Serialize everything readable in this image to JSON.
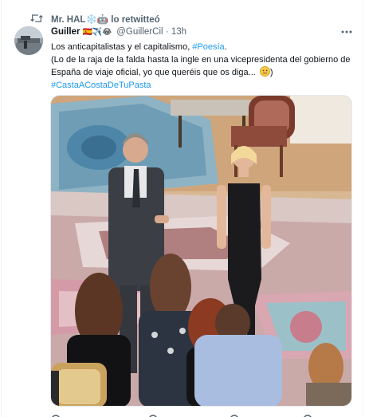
{
  "retweet": {
    "text": "Mr. HAL❄️🤖 lo retwitteó",
    "icon": "retweet-icon"
  },
  "tweet": {
    "author_name": "Guiller",
    "author_emoji": "🇪🇸✈️😂",
    "handle": "@GuillerCil",
    "separator": "·",
    "time": "13h",
    "more_icon": "more-dots-icon",
    "line1_text": "Los anticapitalistas y el capitalismo, ",
    "line1_hashtag": "#Poesía",
    "line1_end": ".",
    "line2": "(Lo de la raja de la falda hasta la ingle en una vicepresidenta del gobierno de",
    "line3": "España de viaje oficial, yo que queréis que os diga...",
    "line3_end": ")",
    "hashtag2": "#CastaACostaDeTuPasta"
  },
  "colors": {
    "accent": "#1d9bf0",
    "text": "#0f1419",
    "muted": "#536471"
  }
}
